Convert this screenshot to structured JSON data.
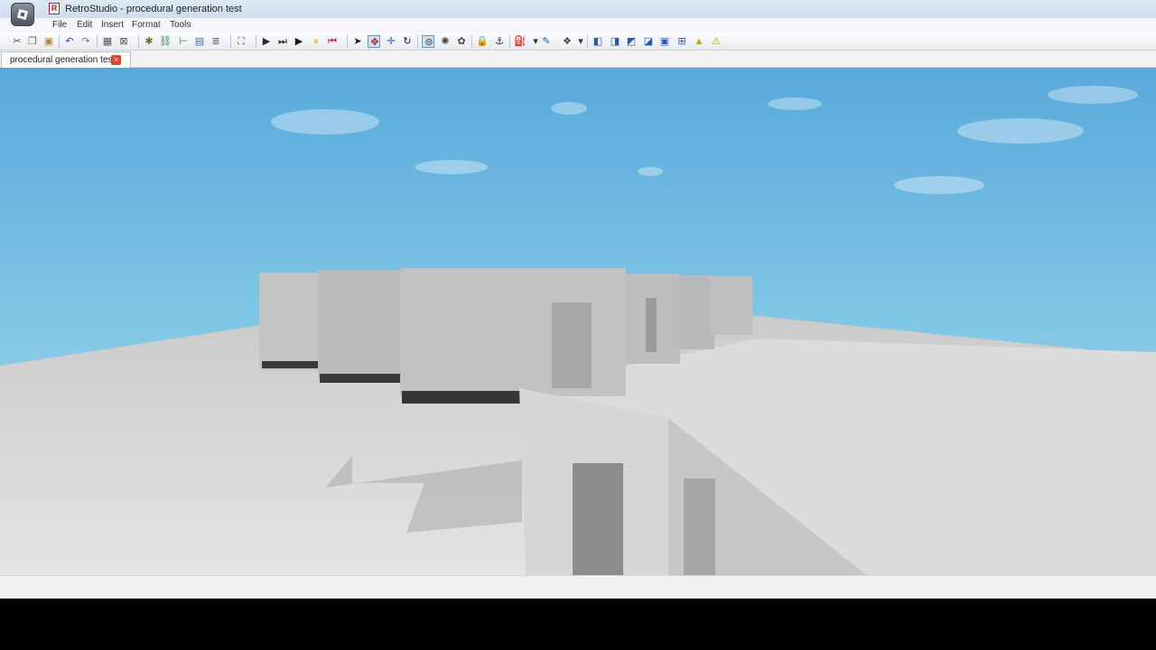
{
  "window": {
    "title": "RetroStudio - procedural generation test",
    "app_icon": "retrostudio-logo-icon",
    "window_icon_glyph": "R"
  },
  "menu": {
    "items": [
      "File",
      "Edit",
      "Insert",
      "Format",
      "Tools"
    ]
  },
  "toolbar": {
    "buttons": [
      {
        "name": "cut-icon",
        "glyph": "✂",
        "color": "#555555"
      },
      {
        "name": "copy-icon",
        "glyph": "❐",
        "color": "#666666"
      },
      {
        "name": "paste-icon",
        "glyph": "▣",
        "color": "#b08a2e"
      },
      {
        "name": "undo-icon",
        "glyph": "↶",
        "color": "#2a55b5"
      },
      {
        "name": "redo-icon",
        "glyph": "↷",
        "color": "#777777"
      },
      {
        "name": "group-icon",
        "glyph": "▦",
        "color": "#555555"
      },
      {
        "name": "ungroup-icon",
        "glyph": "⊠",
        "color": "#555555"
      },
      {
        "name": "weld-icon",
        "glyph": "✱",
        "color": "#7a6a3a"
      },
      {
        "name": "link-icon",
        "glyph": "⛓",
        "color": "#3a7a3a"
      },
      {
        "name": "hierarchy-icon",
        "glyph": "⊢",
        "color": "#3a8a3a"
      },
      {
        "name": "grid-icon",
        "glyph": "▤",
        "color": "#4a6ab0"
      },
      {
        "name": "list-icon",
        "glyph": "≣",
        "color": "#555555"
      },
      {
        "name": "fit-icon",
        "glyph": "⛶",
        "color": "#555555"
      },
      {
        "name": "run-icon",
        "glyph": "▶",
        "color": "#2a2a2a"
      },
      {
        "name": "step-icon",
        "glyph": "⏭",
        "color": "#2a2a2a"
      },
      {
        "name": "play-icon",
        "glyph": "▶",
        "color": "#1a1a1a"
      },
      {
        "name": "pause-icon",
        "glyph": "⏸",
        "color": "#d4c400"
      },
      {
        "name": "reset-icon",
        "glyph": "⏮",
        "color": "#d0157a"
      },
      {
        "name": "select-tool-icon",
        "glyph": "➤",
        "color": "#1a1a1a"
      },
      {
        "name": "move-tool-icon",
        "glyph": "✥",
        "color": "#b02020"
      },
      {
        "name": "drag-tool-icon",
        "glyph": "✛",
        "color": "#2a55b5"
      },
      {
        "name": "rotate-tool-icon",
        "glyph": "↻",
        "color": "#1a1a1a"
      },
      {
        "name": "snap-icon",
        "glyph": "⊚",
        "color": "#444444"
      },
      {
        "name": "collision-icon",
        "glyph": "✺",
        "color": "#444444"
      },
      {
        "name": "join-icon",
        "glyph": "✿",
        "color": "#444444"
      },
      {
        "name": "lock-icon",
        "glyph": "🔒",
        "color": "#d4a000"
      },
      {
        "name": "anchor-icon",
        "glyph": "⚓",
        "color": "#2a2a2a"
      },
      {
        "name": "paint-bucket-icon",
        "glyph": "⛽",
        "color": "#4a6ab0"
      },
      {
        "name": "dropdown-icon",
        "glyph": "▾",
        "color": "#333333"
      },
      {
        "name": "paint-brush-icon",
        "glyph": "✎",
        "color": "#2a55b5"
      },
      {
        "name": "material-icon",
        "glyph": "❖",
        "color": "#444444"
      },
      {
        "name": "dropdown-icon",
        "glyph": "▾",
        "color": "#333333"
      },
      {
        "name": "view-front-icon",
        "glyph": "◧",
        "color": "#2a55b5"
      },
      {
        "name": "view-left-icon",
        "glyph": "◨",
        "color": "#2a55b5"
      },
      {
        "name": "view-top-icon",
        "glyph": "◩",
        "color": "#2a55b5"
      },
      {
        "name": "view-right-icon",
        "glyph": "◪",
        "color": "#2a55b5"
      },
      {
        "name": "view-back-icon",
        "glyph": "▣",
        "color": "#2a55b5"
      },
      {
        "name": "zoom-extents-icon",
        "glyph": "⊞",
        "color": "#2a55b5"
      },
      {
        "name": "terrain-icon",
        "glyph": "▲",
        "color": "#c8a000"
      },
      {
        "name": "warning-icon",
        "glyph": "⚠",
        "color": "#c8a000"
      }
    ],
    "active_tools": [
      "move-tool-icon",
      "snap-icon"
    ]
  },
  "document_tabs": [
    {
      "label": "procedural generation test",
      "close_icon": "close-tab-icon",
      "close_glyph": "×"
    }
  ],
  "viewport": {
    "scene": "3d-viewport",
    "sky_top_color": "#5aa9dc",
    "sky_horizon_color": "#a7e3ef",
    "baseplate_color": "#d7d7d7",
    "wall_color": "#bdbdbd"
  },
  "status_bar": {
    "text": ""
  }
}
